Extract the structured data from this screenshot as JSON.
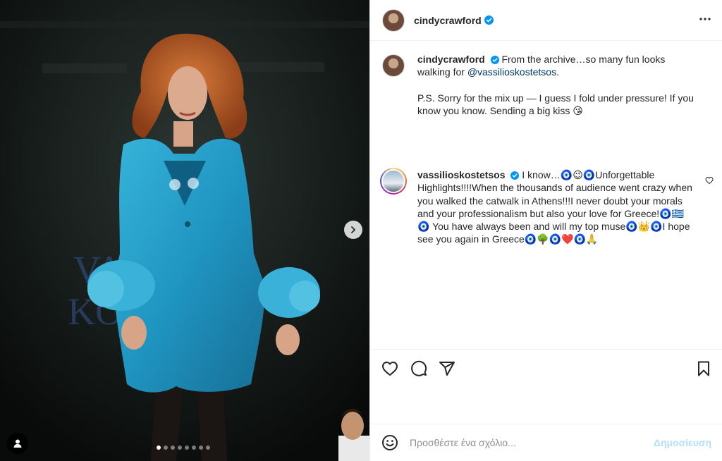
{
  "post": {
    "author": "cindycrawford",
    "media_slides": 8,
    "active_slide": 1
  },
  "caption": {
    "username": "cindycrawford",
    "text_line1": "From the archive…so many fun looks walking for ",
    "mention": "@vassilioskostetsos",
    "text_line1_end": ".",
    "text_line2": "P.S. Sorry for the mix up — I guess I fold under pressure! If you know you know. Sending a big kiss 😘"
  },
  "comment": {
    "username": "vassilioskostetsos",
    "text": "I know…🧿😉🧿Unforgettable Highlights!!!!When the thousands of audience went crazy when you walked the catwalk in Athens!!!I never doubt your morals and your professionalism but also your love for Greece!🧿🇬🇷🧿 You have always been and will my top muse🧿👑🧿I hope see you again in Greece🧿🌳🧿❤️🧿🙏"
  },
  "composer": {
    "placeholder": "Προσθέστε ένα σχόλιο...",
    "post_label": "Δημοσίευση"
  },
  "icons": {
    "more": "more-horizontal-icon",
    "like": "heart-icon",
    "comment": "comment-icon",
    "share": "paper-plane-icon",
    "save": "bookmark-icon",
    "emoji": "smiley-icon",
    "next": "chevron-right-icon",
    "tagged": "user-tag-icon",
    "verified": "verified-badge-icon"
  },
  "colors": {
    "verified": "#0095f6",
    "mention": "#00376b",
    "post_disabled": "#b2dffc"
  }
}
